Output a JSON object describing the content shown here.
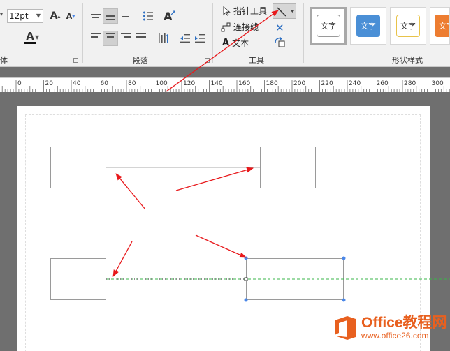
{
  "ribbon": {
    "font_group": {
      "label_partial": "体",
      "font_size": "12pt"
    },
    "paragraph_group": {
      "label": "段落"
    },
    "tools_group": {
      "label": "工具",
      "pointer_tool": "指针工具",
      "connector": "连接线",
      "text": "文本"
    },
    "shape_styles": {
      "label": "形状样式",
      "items": [
        "文字",
        "文字",
        "文字",
        "文字"
      ]
    }
  },
  "ruler": {
    "ticks": [
      "0",
      "20",
      "40",
      "60",
      "80",
      "100",
      "120",
      "140",
      "160",
      "180",
      "200",
      "220",
      "240",
      "260",
      "280",
      "300"
    ]
  },
  "watermark": {
    "line1": "Office教程网",
    "line2": "www.office26.com"
  },
  "colors": {
    "annotation_arrow": "#e8191c",
    "selection_handle": "#4a87e8",
    "guide_line": "#39b54a",
    "brand_orange": "#e8601f",
    "style_blue": "#4a8fd6",
    "style_yellow_border": "#e8c34a",
    "style_orange": "#ed7d31"
  }
}
